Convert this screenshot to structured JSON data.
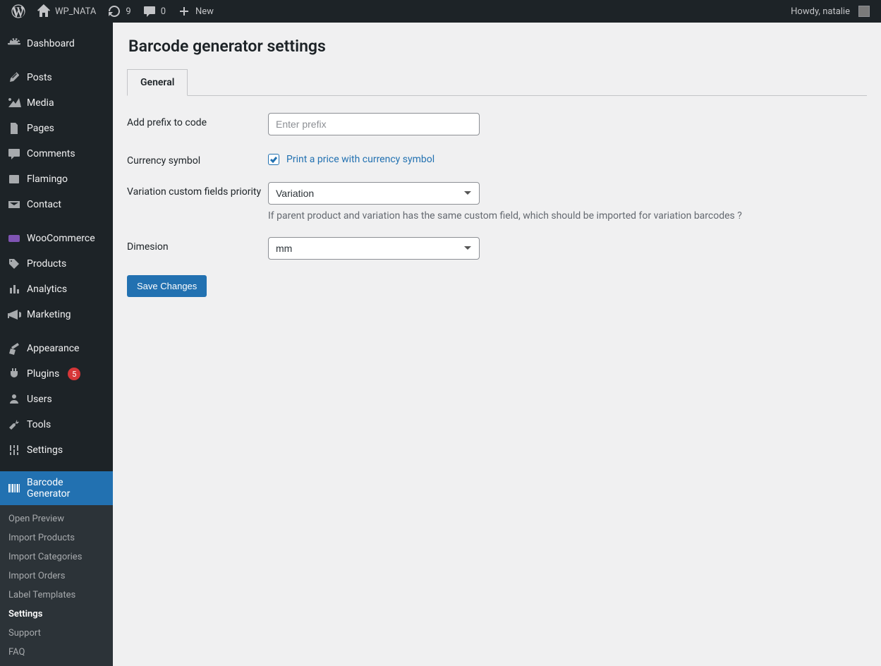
{
  "adminbar": {
    "site_name": "WP_NATA",
    "updates": "9",
    "comments": "0",
    "new_label": "New",
    "howdy": "Howdy, natalie"
  },
  "sidebar": {
    "items": [
      {
        "id": "dashboard",
        "label": "Dashboard"
      },
      {
        "id": "posts",
        "label": "Posts"
      },
      {
        "id": "media",
        "label": "Media"
      },
      {
        "id": "pages",
        "label": "Pages"
      },
      {
        "id": "comments",
        "label": "Comments"
      },
      {
        "id": "flamingo",
        "label": "Flamingo"
      },
      {
        "id": "contact",
        "label": "Contact"
      },
      {
        "id": "woocommerce",
        "label": "WooCommerce"
      },
      {
        "id": "products",
        "label": "Products"
      },
      {
        "id": "analytics",
        "label": "Analytics"
      },
      {
        "id": "marketing",
        "label": "Marketing"
      },
      {
        "id": "appearance",
        "label": "Appearance"
      },
      {
        "id": "plugins",
        "label": "Plugins",
        "badge": "5"
      },
      {
        "id": "users",
        "label": "Users"
      },
      {
        "id": "tools",
        "label": "Tools"
      },
      {
        "id": "settings",
        "label": "Settings"
      },
      {
        "id": "barcode",
        "label": "Barcode Generator"
      }
    ],
    "submenu": [
      {
        "label": "Open Preview"
      },
      {
        "label": "Import Products"
      },
      {
        "label": "Import Categories"
      },
      {
        "label": "Import Orders"
      },
      {
        "label": "Label Templates"
      },
      {
        "label": "Settings",
        "current": true
      },
      {
        "label": "Support"
      },
      {
        "label": "FAQ"
      }
    ]
  },
  "page": {
    "title": "Barcode generator settings",
    "tab": "General",
    "fields": {
      "prefix_label": "Add prefix to code",
      "prefix_placeholder": "Enter prefix",
      "currency_label": "Currency symbol",
      "currency_checkbox": "Print a price with currency symbol",
      "variation_label": "Variation custom fields priority",
      "variation_value": "Variation",
      "variation_help": "If parent product and variation has the same custom field, which should be imported for variation barcodes ?",
      "dimension_label": "Dimesion",
      "dimension_value": "mm"
    },
    "save_button": "Save Changes"
  }
}
